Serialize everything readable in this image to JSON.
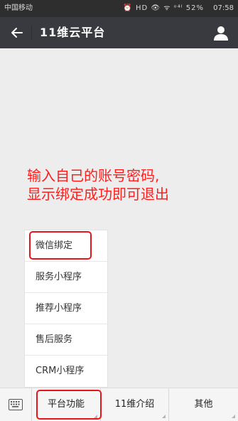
{
  "status_bar": {
    "carrier": "中国移动",
    "icons_text": "⏰ HD 👁 ᯤ ᵒ⁴ᴵ 52%",
    "time": "07:58"
  },
  "header": {
    "back_icon": "back-arrow-icon",
    "title": "11维云平台",
    "user_icon": "user-icon"
  },
  "annotation": {
    "line1": "输入自己的账号密码,",
    "line2": "显示绑定成功即可退出",
    "color": "#ff1e1e"
  },
  "popup_menu": {
    "items": [
      {
        "label": "微信绑定"
      },
      {
        "label": "服务小程序"
      },
      {
        "label": "推荐小程序"
      },
      {
        "label": "售后服务"
      },
      {
        "label": "CRM小程序"
      }
    ]
  },
  "bottom_menu": {
    "keyboard_icon": "keyboard-icon",
    "tabs": [
      {
        "label": "平台功能"
      },
      {
        "label": "11维介绍"
      },
      {
        "label": "其他"
      }
    ]
  },
  "colors": {
    "title_bar": "#393a3f",
    "highlight": "#e8141c"
  }
}
